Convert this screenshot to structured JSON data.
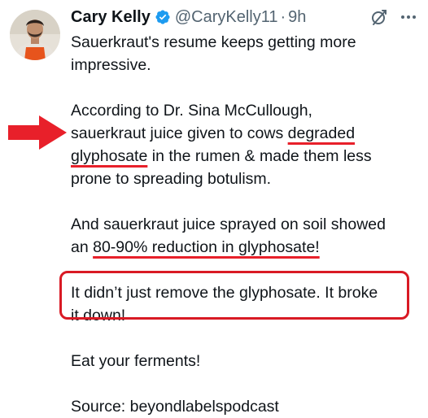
{
  "tweet": {
    "author": {
      "name": "Cary Kelly",
      "handle": "@CaryKelly11",
      "separator": "·",
      "time": "9h",
      "verified": true
    },
    "icons": {
      "grok": "grok-icon",
      "more": "more-icon",
      "verified": "verified-badge-icon"
    },
    "paragraphs": {
      "p1_line1": "Sauerkraut's resume keeps getting more",
      "p1_line2": "impressive.",
      "p2_line1": "According to Dr. Sina McCullough,",
      "p2_line2_a": "sauerkraut juice given to cows ",
      "p2_line2_b": "degraded",
      "p2_line3_a": "glyphosate",
      "p2_line3_b": " in the rumen & made them less",
      "p2_line4": "prone to spreading botulism.",
      "p3_line1": "And sauerkraut juice sprayed on soil showed",
      "p3_line2_a": "an ",
      "p3_line2_b": "80-90% reduction in glyphosate!",
      "p4_line1": "It didn’t just remove the glyphosate. It broke",
      "p4_line2": "it down!",
      "p5_line1": "Eat your ferments!",
      "p6_line1": "Source: beyondlabelspodcast"
    },
    "colors": {
      "text": "#0f1419",
      "muted": "#536471",
      "verified": "#1d9bf0",
      "annotation": "#e8202a"
    }
  }
}
